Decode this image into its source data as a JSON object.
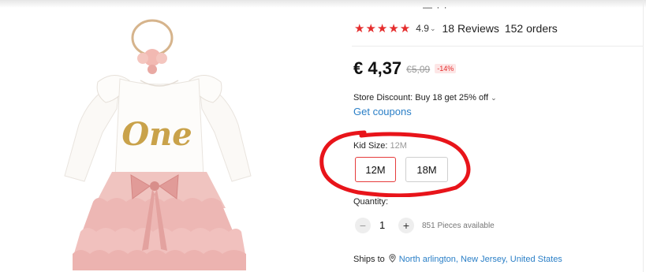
{
  "rating": {
    "stars": 5,
    "star_glyphs": "★★★★★",
    "value": "4.9",
    "caret": "⌄",
    "reviews": "18 Reviews",
    "orders": "152 orders",
    "star_color": "#e52d2d"
  },
  "price": {
    "current": "€ 4,37",
    "original": "€5,09",
    "discount": "-14%"
  },
  "store_discount": {
    "text": "Store Discount: Buy 18 get 25% off",
    "caret": "⌄"
  },
  "coupons": {
    "label": "Get coupons"
  },
  "size": {
    "label": "Kid Size:",
    "selected_value": "12M",
    "options": [
      "12M",
      "18M"
    ]
  },
  "quantity": {
    "label": "Quantity:",
    "minus": "−",
    "value": "1",
    "plus": "+",
    "available": "851 Pieces available"
  },
  "shipping": {
    "label": "Ships to",
    "location": "North arlington, New Jersey, United States"
  },
  "product_image": {
    "print_text": "One"
  },
  "colors": {
    "accent_red": "#e52d2d",
    "link_blue": "#2a7fc7",
    "annotation_red": "#e8141a"
  }
}
